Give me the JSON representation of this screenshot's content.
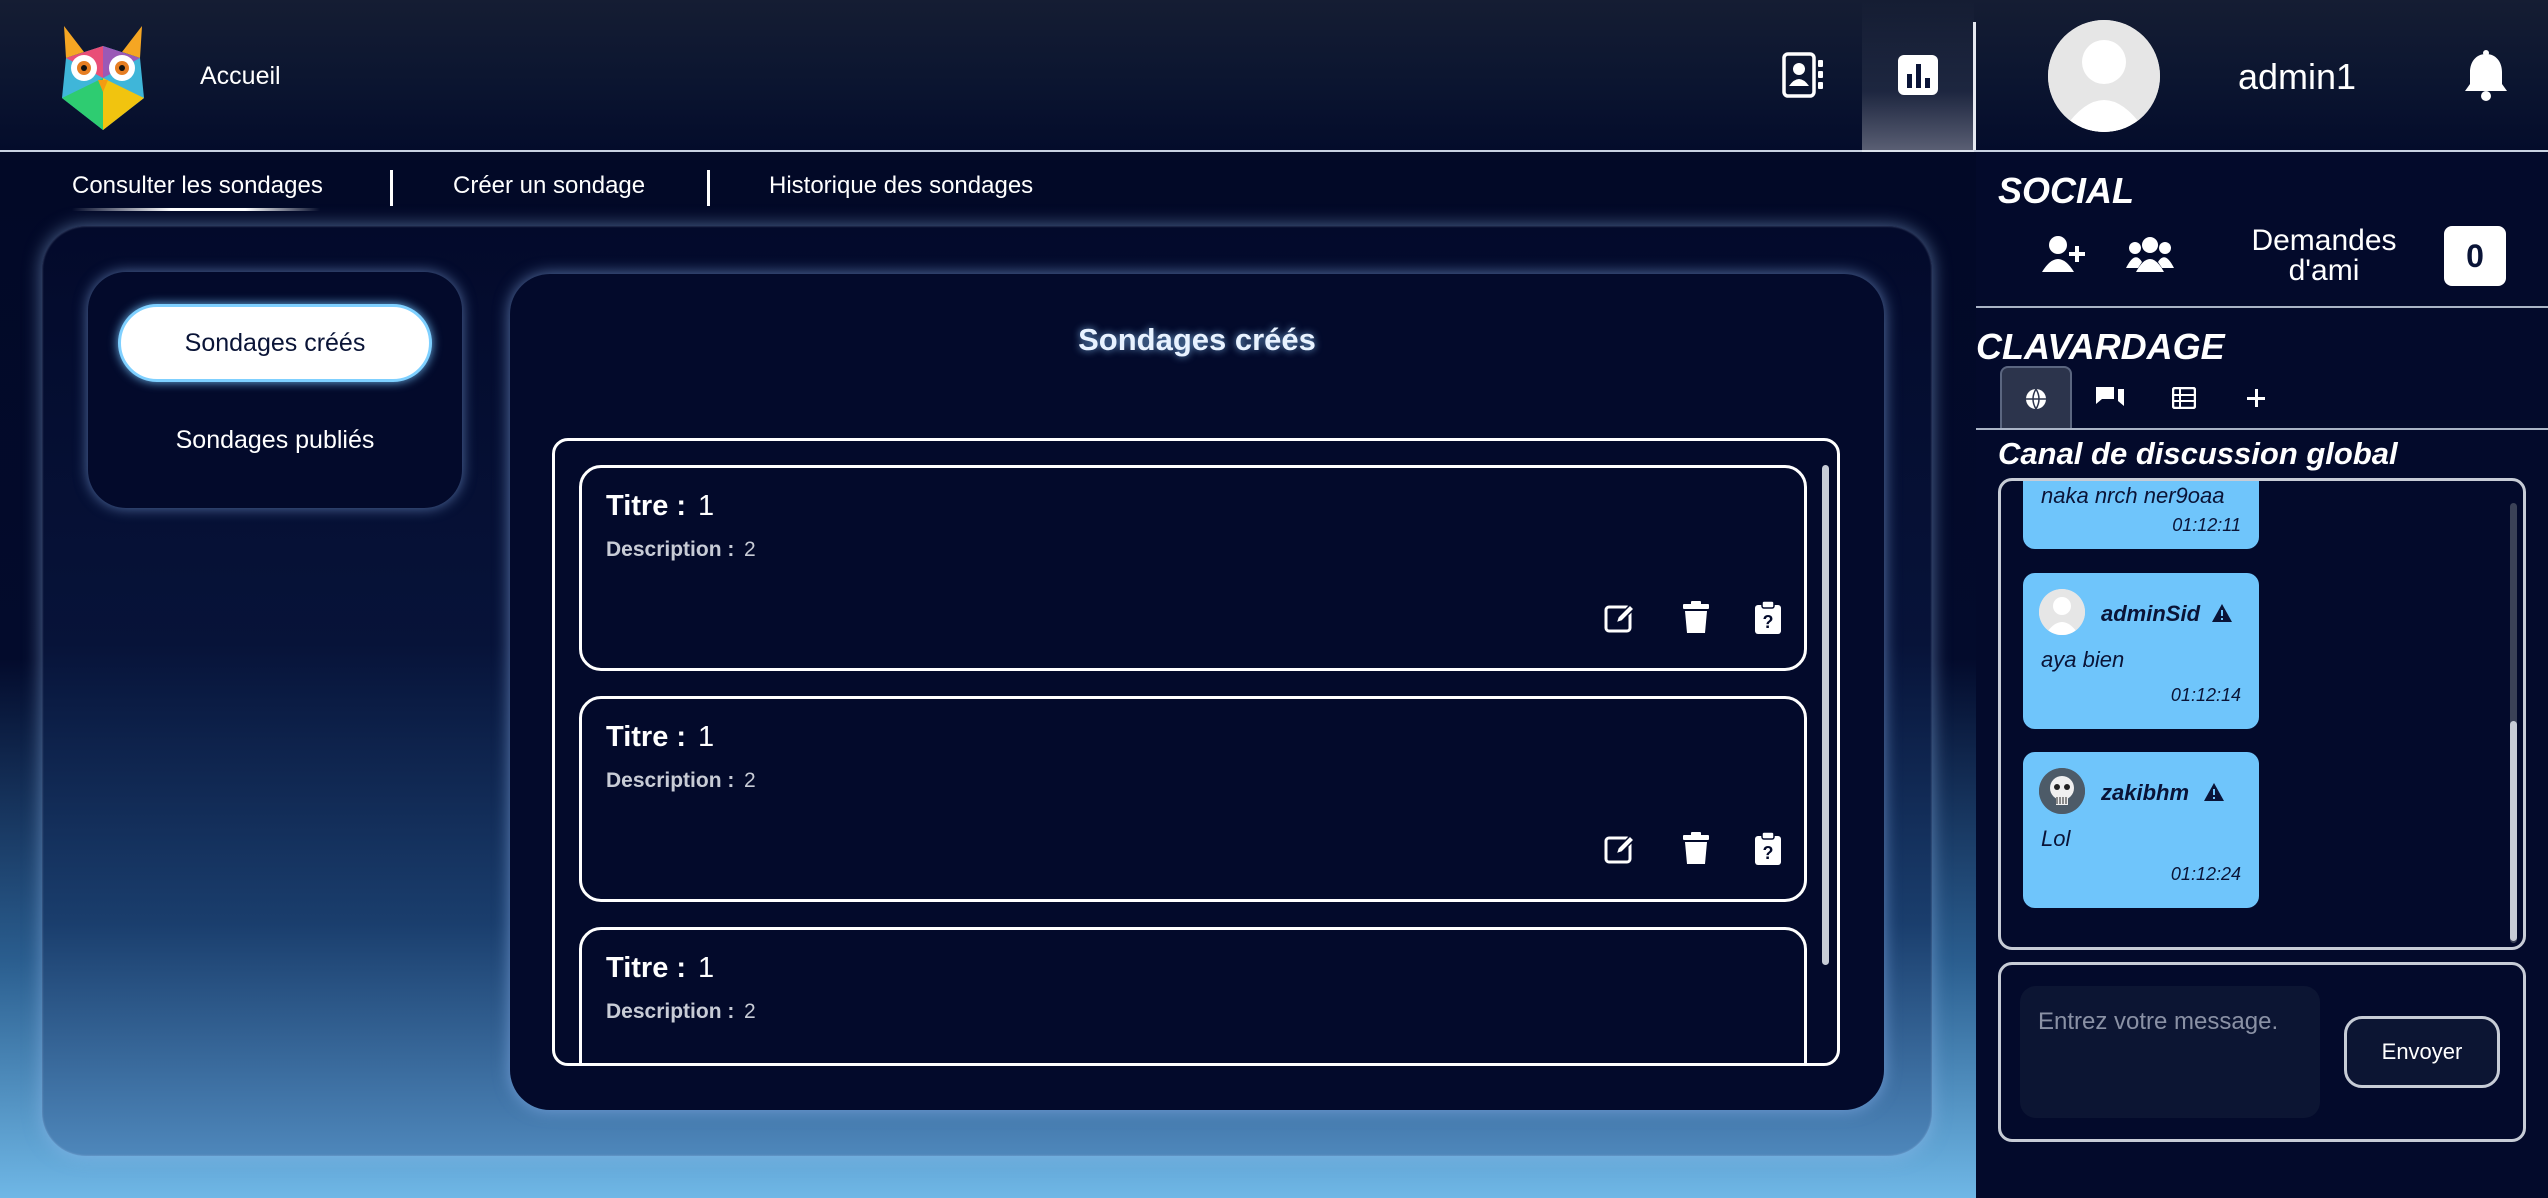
{
  "header": {
    "home_label": "Accueil",
    "username": "admin1"
  },
  "subnav": {
    "items": [
      "Consulter les sondages",
      "Créer un sondage",
      "Historique des sondages"
    ]
  },
  "side_menu": {
    "created_label": "Sondages créés",
    "published_label": "Sondages publiés"
  },
  "content": {
    "title": "Sondages créés",
    "cards": [
      {
        "title_label": "Titre :",
        "title": "1",
        "desc_label": "Description :",
        "desc": "2"
      },
      {
        "title_label": "Titre :",
        "title": "1",
        "desc_label": "Description :",
        "desc": "2"
      },
      {
        "title_label": "Titre :",
        "title": "1",
        "desc_label": "Description :",
        "desc": "2"
      }
    ]
  },
  "social": {
    "title": "SOCIAL",
    "friend_requests_label": "Demandes d'ami",
    "friend_requests_count": "0"
  },
  "chat": {
    "title": "CLAVARDAGE",
    "channel_title": "Canal de discussion global",
    "messages": [
      {
        "user": "",
        "text": "naka nrch ner9oaa",
        "time": "01:12:11"
      },
      {
        "user": "adminSid",
        "text": "aya bien",
        "time": "01:12:14"
      },
      {
        "user": "zakibhm",
        "text": "Lol",
        "time": "01:12:24"
      }
    ],
    "input_placeholder": "Entrez votre message.",
    "send_label": "Envoyer"
  },
  "colors": {
    "bubble": "#6fc5fb",
    "panel": "#030a2b",
    "accent_glow": "#7fd0ff"
  }
}
